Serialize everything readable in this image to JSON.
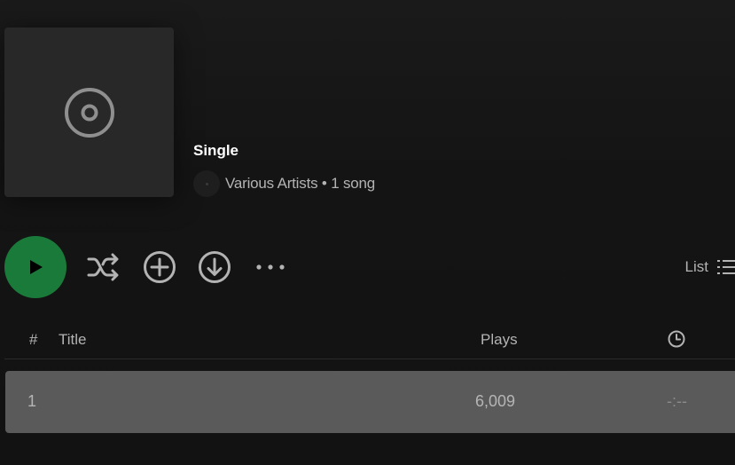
{
  "album": {
    "type_label": "Single",
    "artist": "Various Artists",
    "separator": " • ",
    "song_count": "1 song",
    "cover_icon": "disc-icon",
    "artist_avatar_icon": "artist-avatar"
  },
  "actions": {
    "play_icon": "play-icon",
    "shuffle_icon": "shuffle-icon",
    "add_icon": "add-circle-icon",
    "download_icon": "download-circle-icon",
    "more_icon": "more-horizontal-icon",
    "view_label": "List",
    "view_icon": "list-view-icon"
  },
  "table": {
    "headers": {
      "number": "#",
      "title": "Title",
      "plays": "Plays",
      "duration_icon": "clock-icon"
    },
    "rows": [
      {
        "number": "1",
        "title": "",
        "plays": "6,009",
        "duration": "-:--"
      }
    ]
  },
  "colors": {
    "background": "#121212",
    "play_button": "#1a7a3a",
    "row_highlight": "#5a5a5a",
    "text_primary": "#ffffff",
    "text_secondary": "#b3b3b3"
  }
}
